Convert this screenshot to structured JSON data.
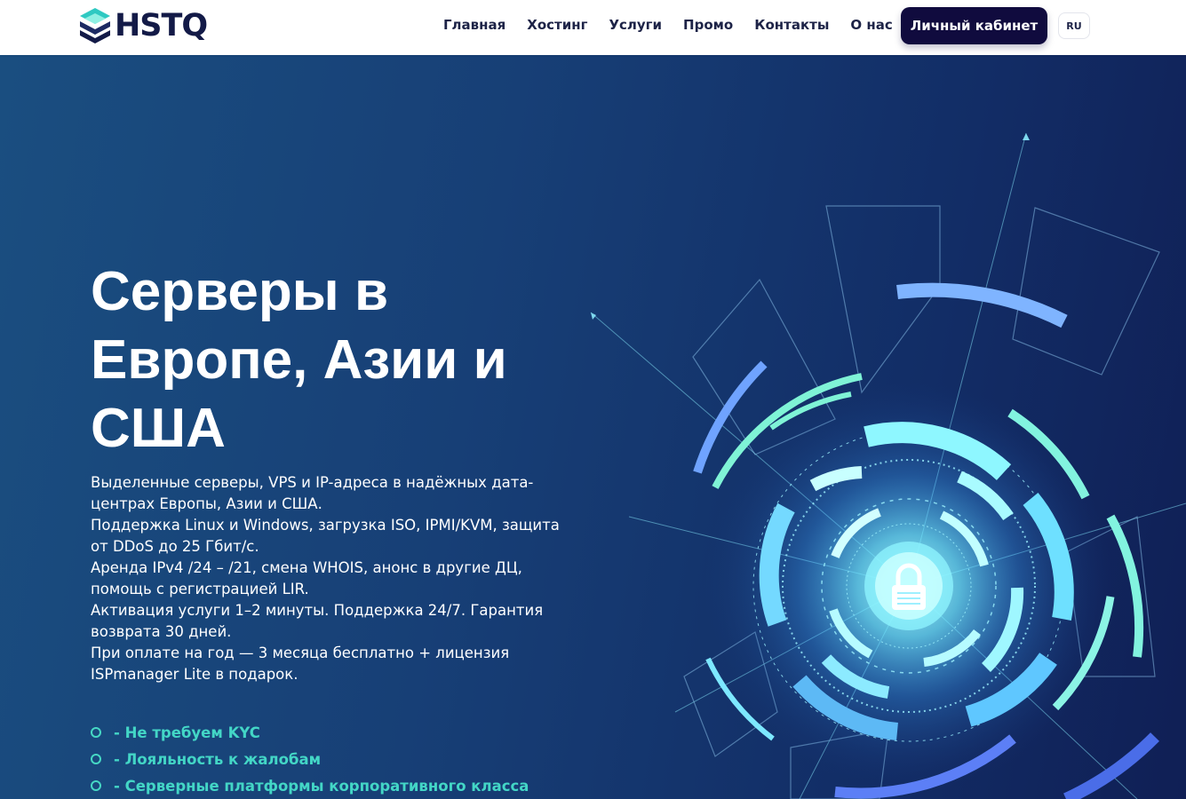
{
  "header": {
    "logo_text": "HSTQ",
    "nav": [
      "Главная",
      "Хостинг",
      "Услуги",
      "Промо",
      "Контакты",
      "О нас"
    ],
    "cabinet_label": "Личный кабинет",
    "lang_label": "RU"
  },
  "hero": {
    "title": "Серверы в Европе, Азии и США",
    "description": [
      "Выделенные серверы, VPS и IP-адреса в надёжных дата-центрах Европы, Азии и США.",
      "Поддержка Linux и Windows, загрузка ISO, IPMI/KVM, защита от DDoS до 25 Гбит/с.",
      "Аренда IPv4 /24 – /21, смена WHOIS, анонс в другие ДЦ, помощь с регистрацией LIR.",
      "Активация услуги 1–2 минуты. Поддержка 24/7. Гарантия возврата 30 дней.",
      "При оплате на год — 3 месяца бесплатно + лицензия ISPmanager Lite в подарок."
    ],
    "features": [
      "- Не требуем KYC",
      "- Лояльность к жалобам",
      "- Серверные платформы корпоративного класса"
    ],
    "graphic_icon": "padlock-icon"
  },
  "colors": {
    "brand_dark": "#131a47",
    "button_bg": "#100b3e",
    "accent_teal": "#43d6c6",
    "accent_cyan": "#7de8ff",
    "hero_bg": "#173f76"
  }
}
